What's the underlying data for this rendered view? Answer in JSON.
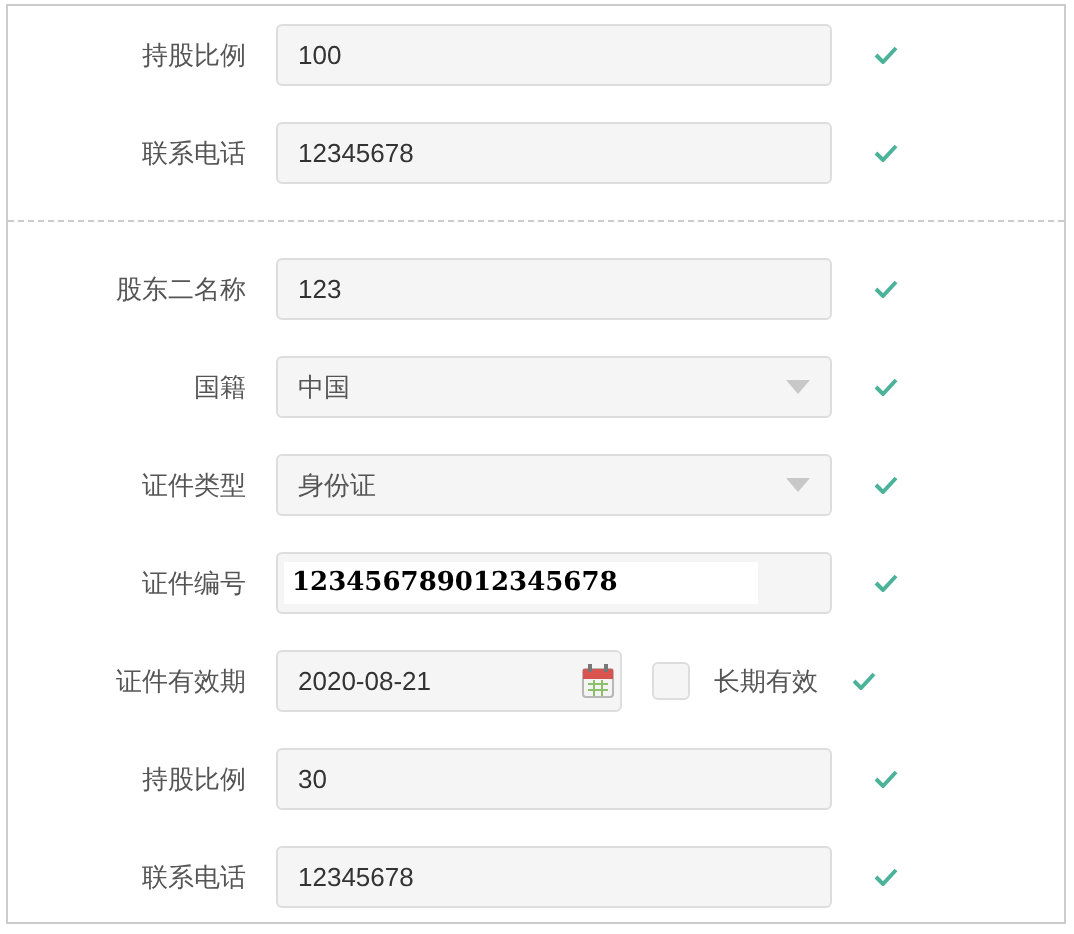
{
  "sections": [
    {
      "fields": [
        {
          "label": "持股比例",
          "kind": "text",
          "value": "100",
          "valid": true
        },
        {
          "label": "联系电话",
          "kind": "text",
          "value": "12345678",
          "valid": true
        }
      ]
    },
    {
      "fields": [
        {
          "label": "股东二名称",
          "kind": "text",
          "value": "123",
          "valid": true
        },
        {
          "label": "国籍",
          "kind": "select",
          "value": "中国",
          "valid": true
        },
        {
          "label": "证件类型",
          "kind": "select",
          "value": "身份证",
          "valid": true
        },
        {
          "label": "证件编号",
          "kind": "idnumber",
          "value": "123456789012345678",
          "valid": true
        },
        {
          "label": "证件有效期",
          "kind": "date",
          "value": "2020-08-21",
          "valid": true,
          "checkbox": {
            "label": "长期有效",
            "checked": false
          }
        },
        {
          "label": "持股比例",
          "kind": "text",
          "value": "30",
          "valid": true
        },
        {
          "label": "联系电话",
          "kind": "text",
          "value": "12345678",
          "valid": true
        }
      ]
    }
  ]
}
